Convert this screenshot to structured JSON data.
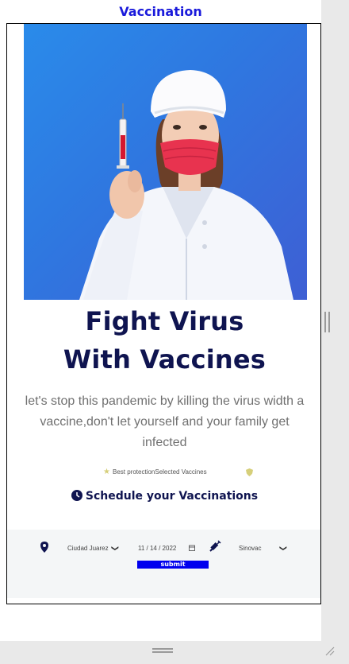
{
  "header": {
    "title": "Vaccination"
  },
  "hero": {
    "headline_line1": "Fight Virus",
    "headline_line2": "With Vaccines",
    "tagline": "let's stop this pandemic by killing the virus width a vaccine,don't let yourself and your family get infected"
  },
  "features": {
    "text": "Best protectionSelected Vaccines"
  },
  "schedule": {
    "title": "Schedule your Vaccinations"
  },
  "form": {
    "location": {
      "value": "Ciudad Juarez"
    },
    "date": {
      "value": "11 / 14 / 2022"
    },
    "vaccine": {
      "value": "Sinovac"
    },
    "submit_label": "submit"
  },
  "colors": {
    "title": "#1a1adb",
    "heading": "#0f1450",
    "submit": "#0000ee",
    "hero_bg": "#2f77e0",
    "form_bg": "#f4f6f7"
  },
  "icons": [
    "location-pin-icon",
    "calendar-icon",
    "syringe-icon",
    "clock-icon",
    "star-icon",
    "shield-icon",
    "chevron-down-icon"
  ]
}
